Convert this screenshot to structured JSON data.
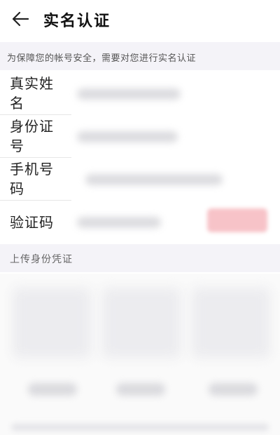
{
  "header": {
    "back_icon": "arrow-left-icon",
    "title": "实名认证"
  },
  "notice": {
    "text": "为保障您的帐号安全，需要对您进行实名认证"
  },
  "form": {
    "name_label": "真实姓名",
    "id_label": "身份证号",
    "phone_label": "手机号码",
    "code_label": "验证码"
  },
  "upload": {
    "section_title": "上传身份凭证"
  },
  "colors": {
    "accent": "#f7c3c8",
    "section_bg": "#f4f3f8"
  }
}
